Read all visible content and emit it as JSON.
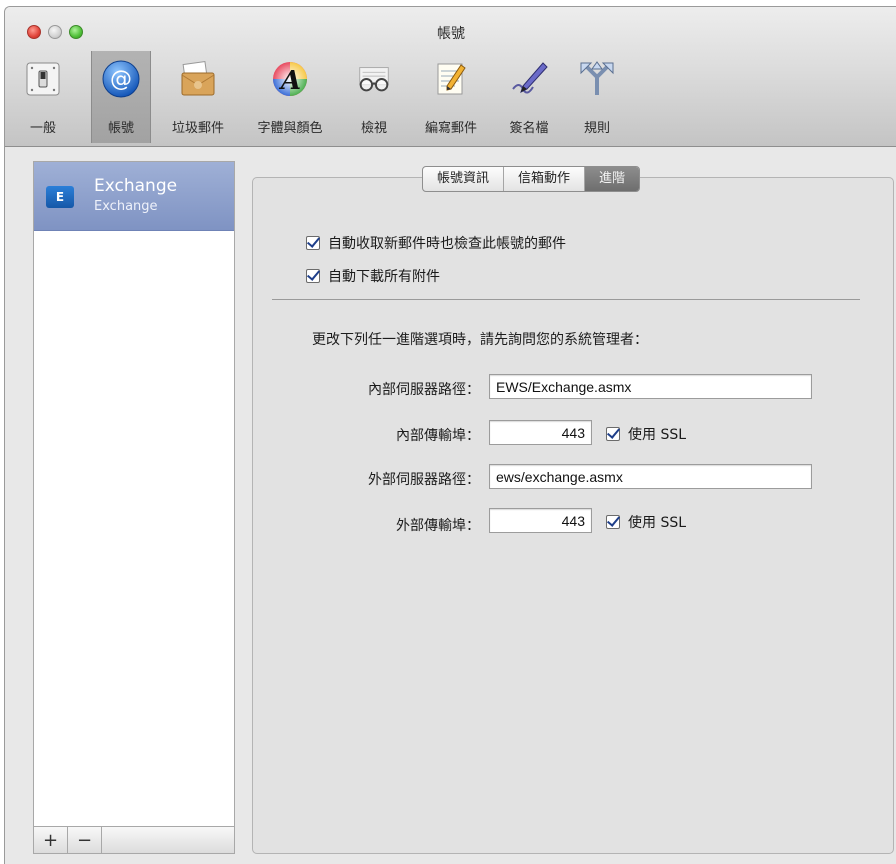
{
  "window": {
    "title": "帳號"
  },
  "toolbar": {
    "items": [
      {
        "label": "一般",
        "icon": "switch-icon"
      },
      {
        "label": "帳號",
        "icon": "at-sign-icon"
      },
      {
        "label": "垃圾郵件",
        "icon": "junk-mail-icon"
      },
      {
        "label": "字體與顏色",
        "icon": "fonts-colors-icon"
      },
      {
        "label": "檢視",
        "icon": "glasses-icon"
      },
      {
        "label": "編寫郵件",
        "icon": "compose-pencil-icon"
      },
      {
        "label": "簽名檔",
        "icon": "signature-pen-icon"
      },
      {
        "label": "規則",
        "icon": "rules-arrows-icon"
      }
    ],
    "selected_index": 1
  },
  "sidebar": {
    "account_name": "Exchange",
    "account_type": "Exchange",
    "account_icon_text": "E",
    "add_label": "+",
    "remove_label": "−"
  },
  "tabs": {
    "items": [
      "帳號資訊",
      "信箱動作",
      "進階"
    ],
    "active": "進階"
  },
  "advanced": {
    "check_new_mail_label": "自動收取新郵件時也檢查此帳號的郵件",
    "check_new_mail_checked": true,
    "download_attachments_label": "自動下載所有附件",
    "download_attachments_checked": true,
    "admin_note": "更改下列任一進階選項時，請先詢問您的系統管理者：",
    "internal_server_label": "內部伺服器路徑：",
    "internal_server_value": "EWS/Exchange.asmx",
    "internal_port_label": "內部傳輸埠：",
    "internal_port_value": "443",
    "internal_ssl_label": "使用 SSL",
    "internal_ssl_checked": true,
    "external_server_label": "外部伺服器路徑：",
    "external_server_value": "ews/exchange.asmx",
    "external_port_label": "外部傳輸埠：",
    "external_port_value": "443",
    "external_ssl_label": "使用 SSL",
    "external_ssl_checked": true
  }
}
